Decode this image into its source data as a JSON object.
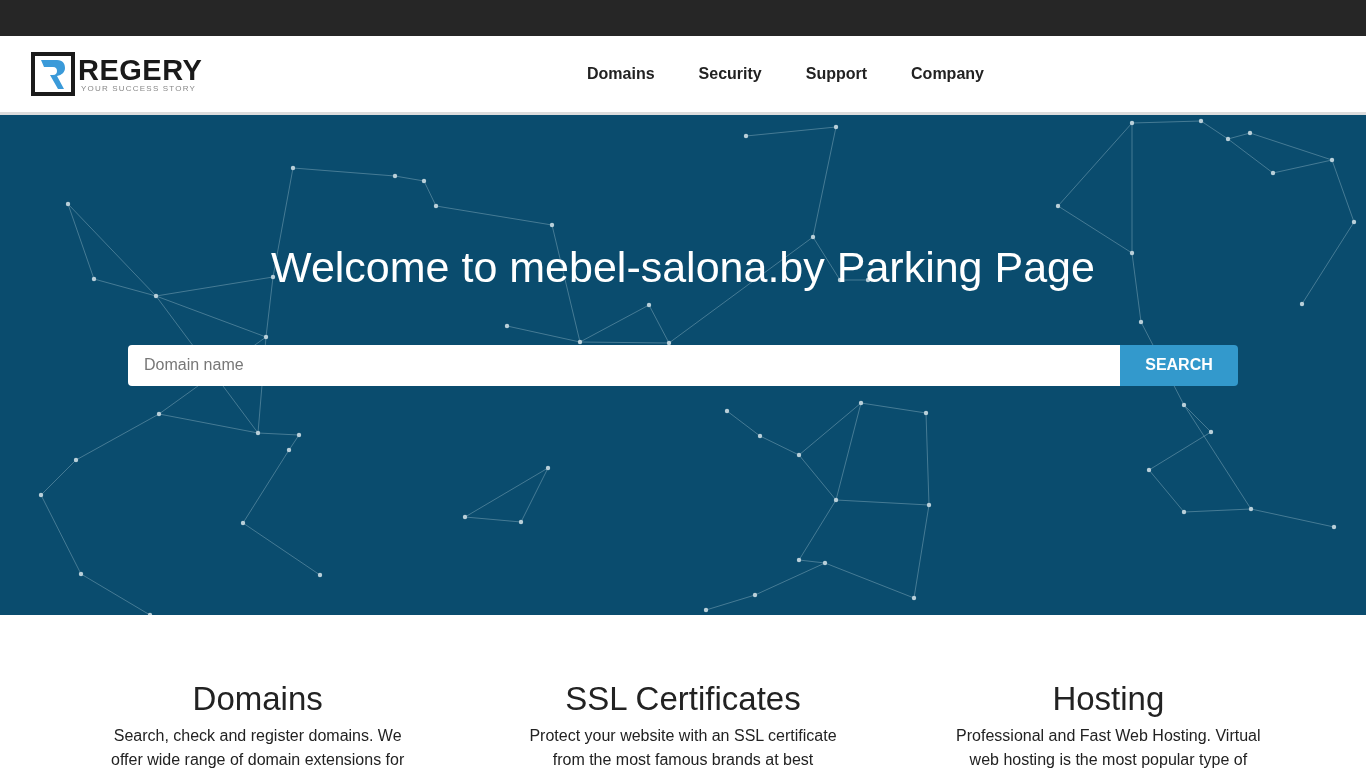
{
  "logo": {
    "name": "REGERY",
    "tagline": "YOUR SUCCESS STORY"
  },
  "nav": [
    {
      "label": "Domains"
    },
    {
      "label": "Security"
    },
    {
      "label": "Support"
    },
    {
      "label": "Company"
    }
  ],
  "hero": {
    "title": "Welcome to mebel-salona.by Parking Page",
    "search": {
      "placeholder": "Domain name",
      "button": "SEARCH"
    }
  },
  "features": [
    {
      "title": "Domains",
      "text": "Search, check and register domains. We offer wide range of domain extensions for"
    },
    {
      "title": "SSL Certificates",
      "text": "Protect your website with an SSL certificate from the most famous brands at best"
    },
    {
      "title": "Hosting",
      "text": "Professional and Fast Web Hosting. Virtual web hosting is the most popular type of"
    }
  ]
}
